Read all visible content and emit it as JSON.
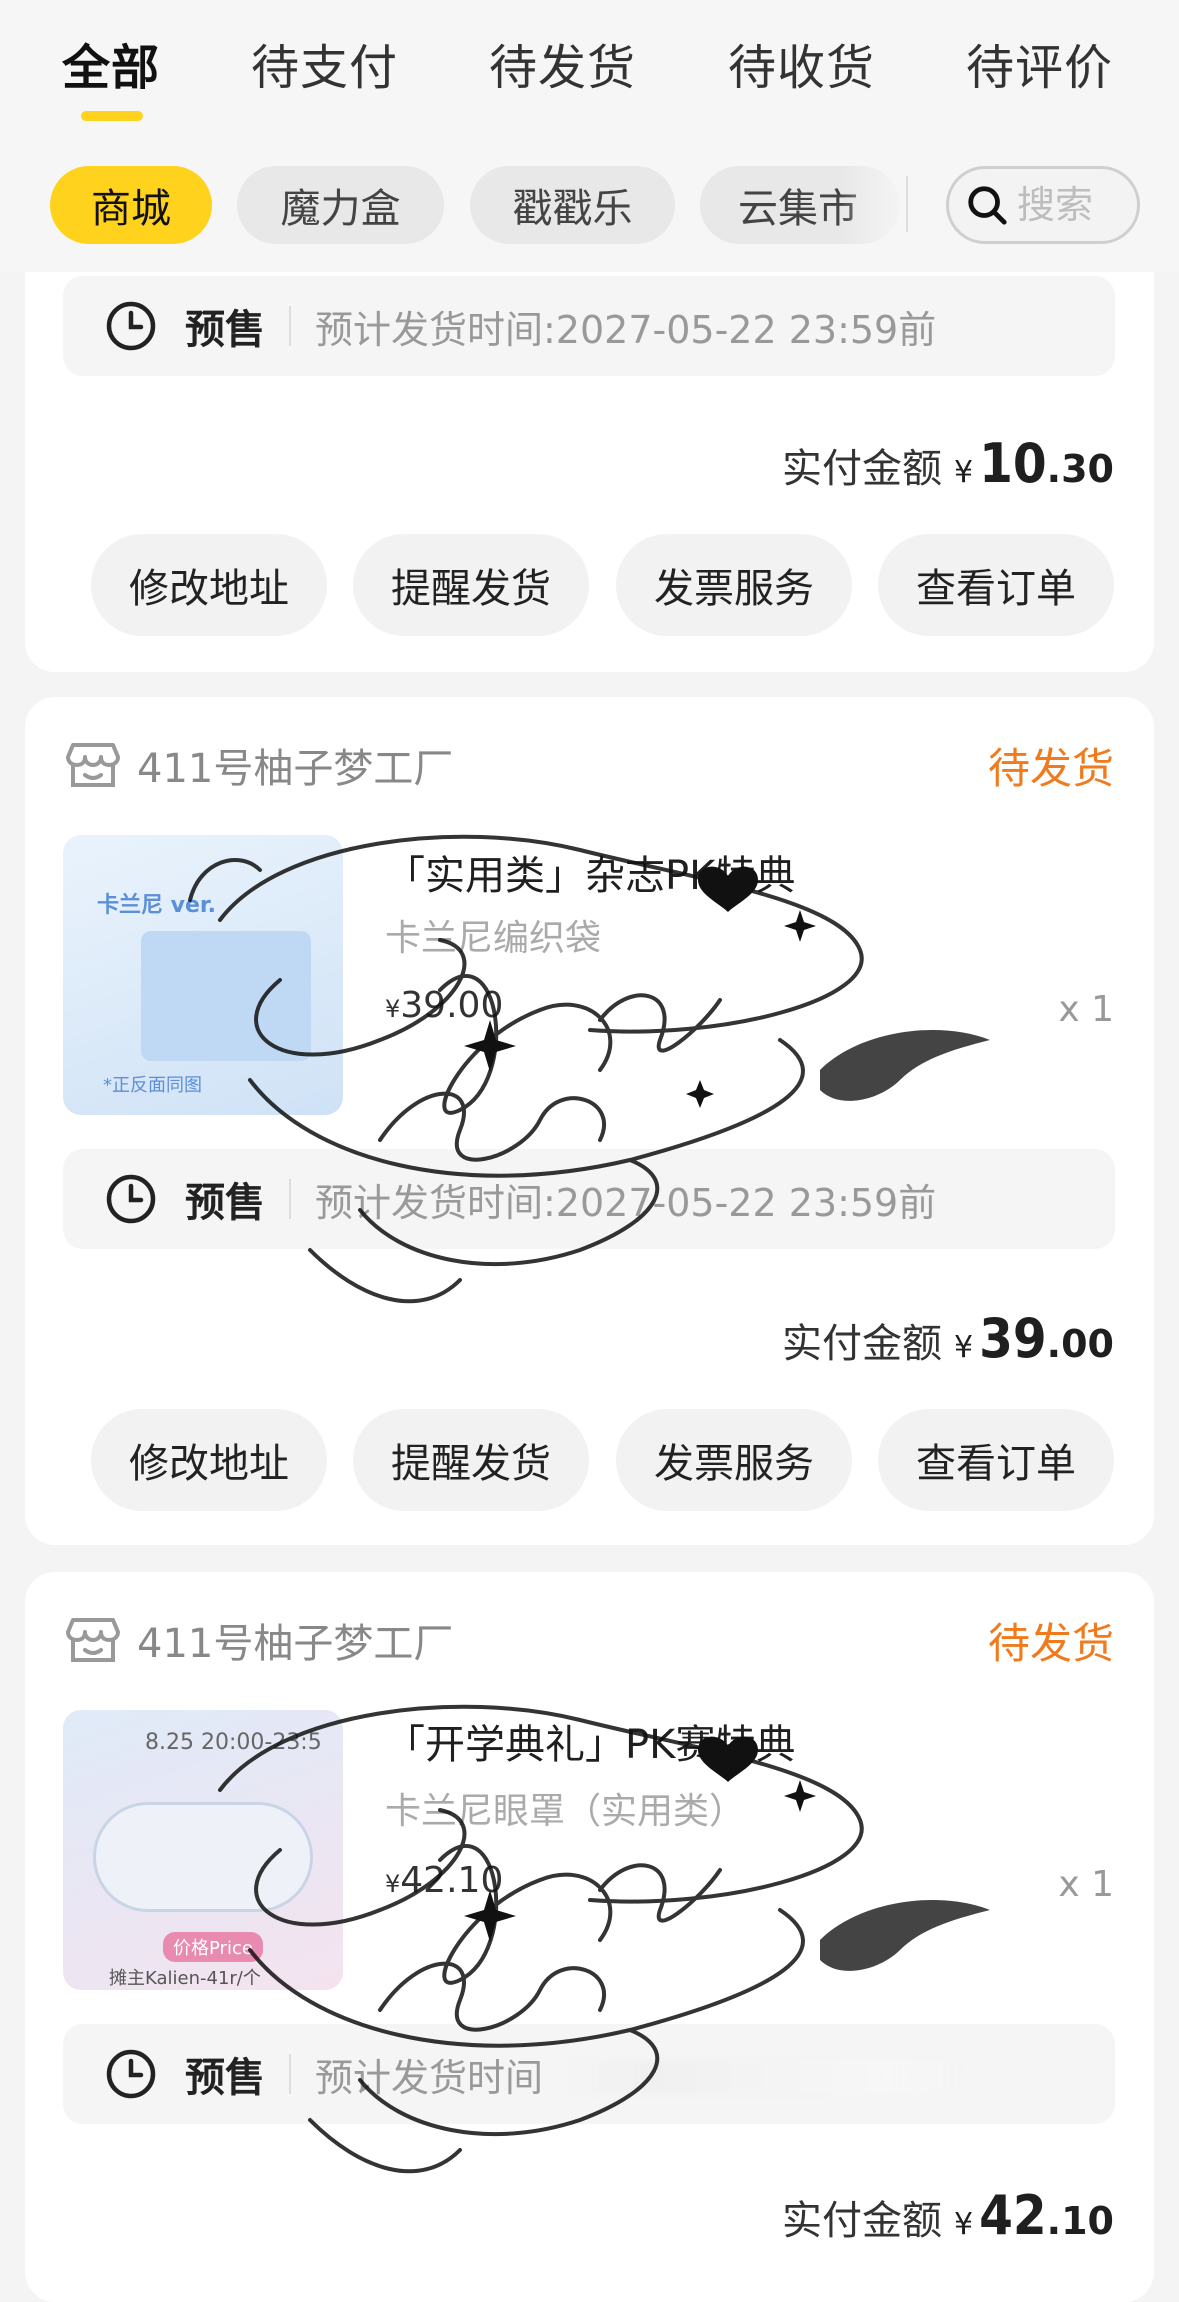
{
  "tabs": [
    "全部",
    "待支付",
    "待发货",
    "待收货",
    "待评价"
  ],
  "filters": [
    "商城",
    "魔力盒",
    "戳戳乐",
    "云集市"
  ],
  "search": {
    "placeholder": "搜索"
  },
  "orders": [
    {
      "presale": {
        "label": "预售",
        "text": "预计发货时间:2027-05-22 23:59前"
      },
      "paid": {
        "label": "实付金额",
        "currency": "¥",
        "int": "10",
        "dec": ".30"
      },
      "buttons": [
        "修改地址",
        "提醒发货",
        "发票服务",
        "查看订单"
      ]
    },
    {
      "shop": "411号柚子梦工厂",
      "status": "待发货",
      "title": "「实用类」杂志PK特典",
      "subtitle": "卡兰尼编织袋",
      "price_yen": "¥",
      "price": "39.00",
      "qty": "x 1",
      "thumb_label": "卡兰尼 ver.",
      "thumb_note": "*正反面同图",
      "presale": {
        "label": "预售",
        "text": "预计发货时间:2027-05-22 23:59前"
      },
      "paid": {
        "label": "实付金额",
        "currency": "¥",
        "int": "39",
        "dec": ".00"
      },
      "buttons": [
        "修改地址",
        "提醒发货",
        "发票服务",
        "查看订单"
      ]
    },
    {
      "shop": "411号柚子梦工厂",
      "status": "待发货",
      "title": "「开学典礼」PK赛特典",
      "subtitle": "卡兰尼眼罩（实用类）",
      "price_yen": "¥",
      "price": "42.10",
      "qty": "x 1",
      "thumb_label": "8.25 20:00-23:5",
      "thumb_note": "价格Price",
      "thumb_footer": "摊主Kalien-41r/个",
      "presale": {
        "label": "预售",
        "text": "预计发货时间"
      },
      "paid": {
        "label": "实付金额",
        "currency": "¥",
        "int": "42",
        "dec": ".10"
      }
    }
  ],
  "colors": {
    "accent": "#ffd21e",
    "status": "#f17a1c"
  }
}
